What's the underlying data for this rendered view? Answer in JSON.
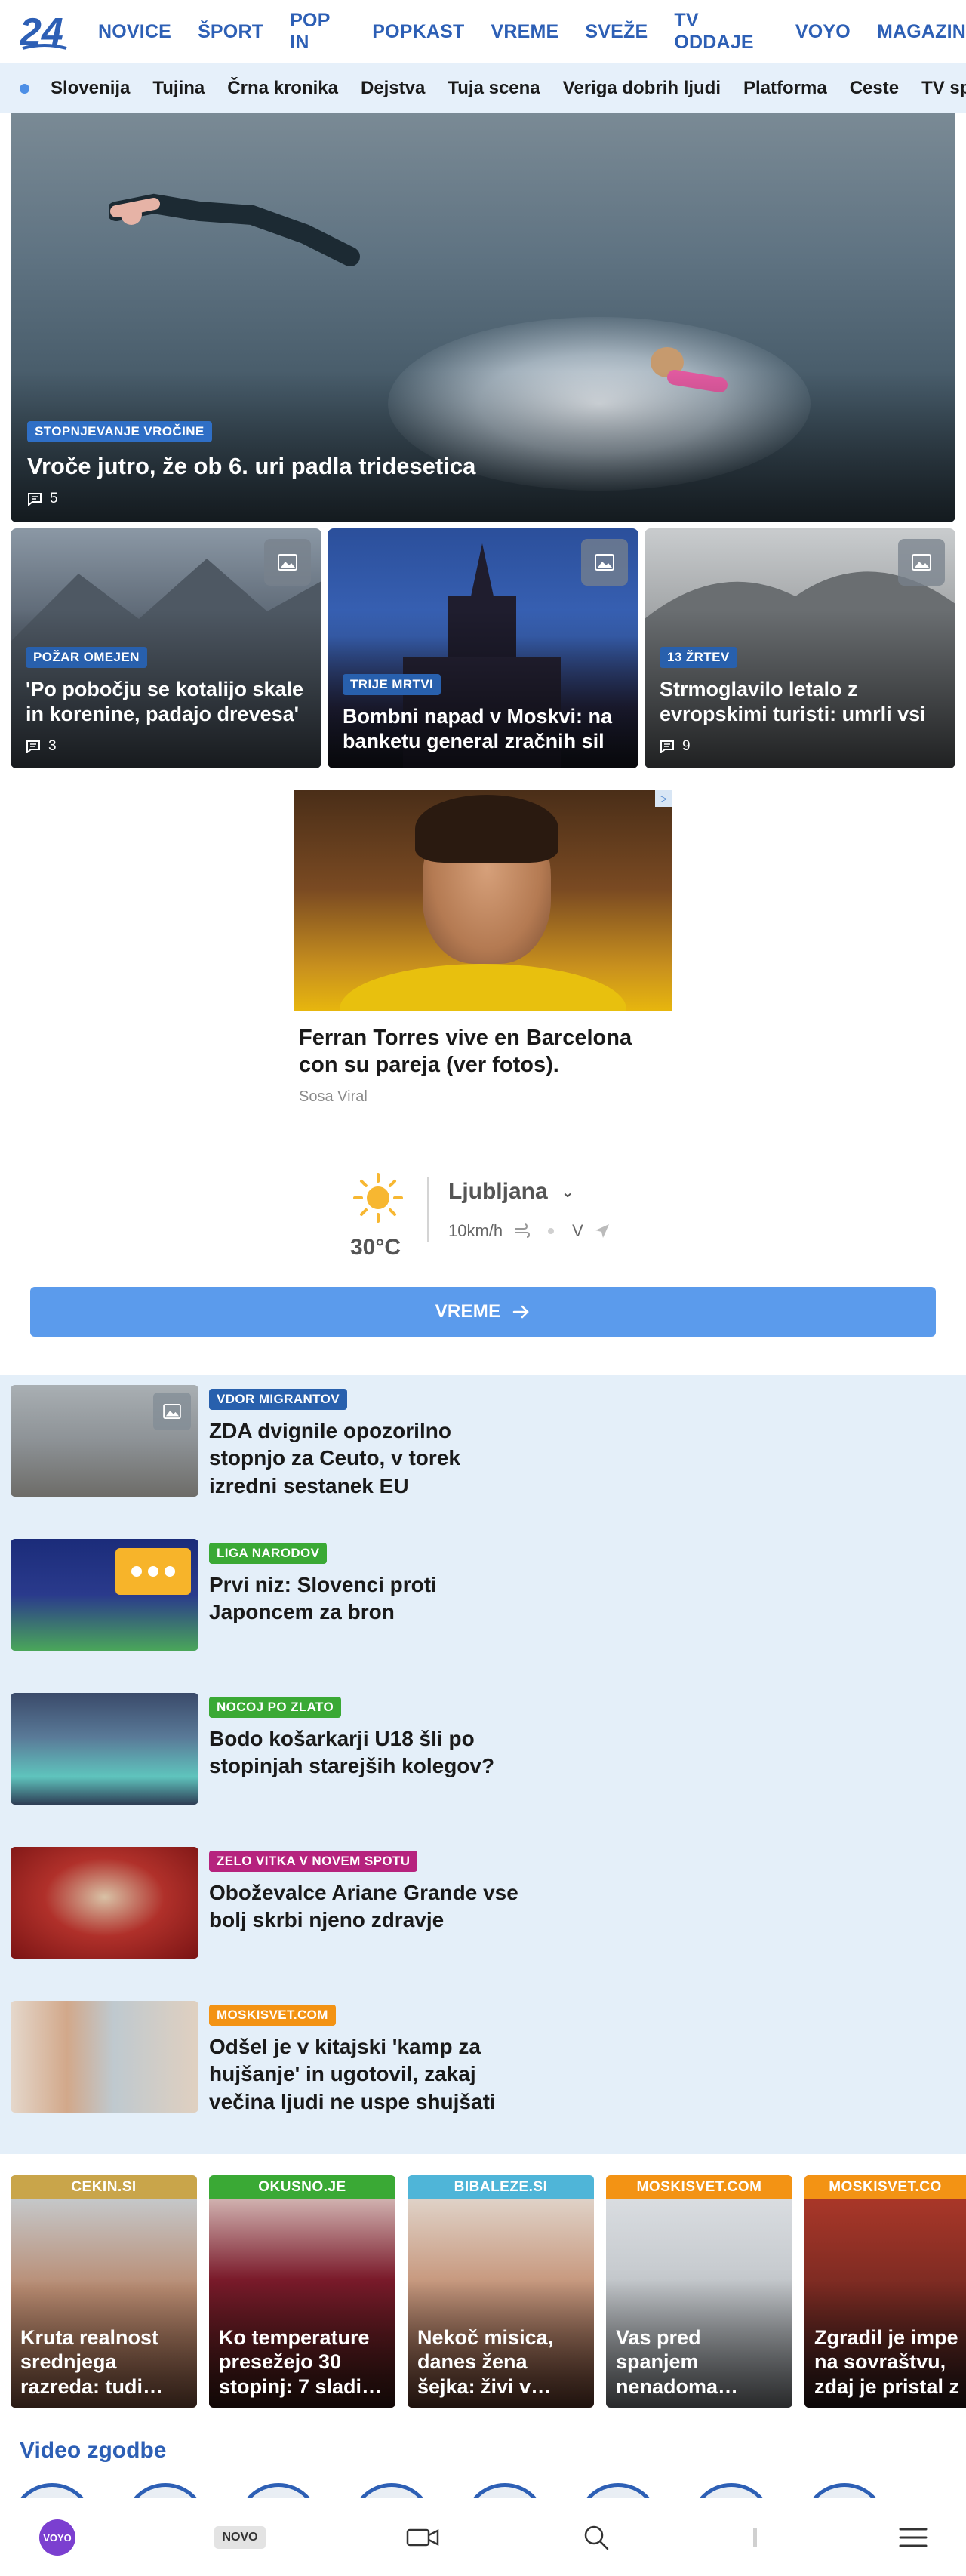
{
  "header": {
    "logo_text": "24",
    "nav": [
      "NOVICE",
      "ŠPORT",
      "POP IN",
      "POPKAST",
      "VREME",
      "SVEŽE",
      "TV ODDAJE",
      "VOYO",
      "MAGAZIN"
    ]
  },
  "subnav": [
    "Slovenija",
    "Tujina",
    "Črna kronika",
    "Dejstva",
    "Tuja scena",
    "Veriga dobrih ljudi",
    "Platforma",
    "Ceste",
    "TV spor"
  ],
  "hero": {
    "badge": "STOPNJEVANJE VROČINE",
    "title": "Vroče jutro, že ob 6. uri padla tridesetica",
    "comments": "5"
  },
  "cards": [
    {
      "badge": "POŽAR OMEJEN",
      "title": "'Po pobočju se kotalijo skale in korenine, padajo drevesa'",
      "comments": "3"
    },
    {
      "badge": "TRIJE MRTVI",
      "title": "Bombni napad v Moskvi: na banketu general zračnih sil",
      "comments": ""
    },
    {
      "badge": "13 ŽRTEV",
      "title": "Strmoglavilo letalo z evropskimi turisti: umrli vsi",
      "comments": "9"
    }
  ],
  "ad": {
    "title": "Ferran Torres vive en Barcelona con su pareja (ver fotos).",
    "source": "Sosa Viral",
    "adchoice": "▷"
  },
  "weather": {
    "temperature": "30°C",
    "city": "Ljubljana",
    "wind_speed": "10km/h",
    "wind_dir": "V",
    "button_label": "VREME"
  },
  "list": [
    {
      "badge": "VDOR MIGRANTOV",
      "badge_color": "#2860ad",
      "title": "ZDA dvignile opozorilno stopnjo za Ceuto, v torek izredni sestanek EU",
      "thumb_icon": "gallery-icon"
    },
    {
      "badge": "LIGA NARODOV",
      "badge_color": "#3aa935",
      "title": "Prvi niz: Slovenci proti Japoncem za bron",
      "thumb_icon": "live-dots-icon"
    },
    {
      "badge": "NOCOJ PO ZLATO",
      "badge_color": "#3aa935",
      "title": "Bodo košarkarji U18 šli po stopinjah starejših kolegov?",
      "thumb_icon": ""
    },
    {
      "badge": "ZELO VITKA V NOVEM SPOTU",
      "badge_color": "#b6237e",
      "title": "Oboževalce Ariane Grande vse bolj skrbi njeno zdravje",
      "thumb_icon": ""
    },
    {
      "badge": "MOSKISVET.COM",
      "badge_color": "#f39314",
      "title": "Odšel je v kitajski 'kamp za hujšanje' in ugotovil, zakaj večina ljudi ne uspe shujšati",
      "thumb_icon": ""
    }
  ],
  "partners": [
    {
      "source": "CEKIN.SI",
      "color": "#c9a54a",
      "title": "Kruta realnost srednjega razreda: tudi…"
    },
    {
      "source": "OKUSNO.JE",
      "color": "#3aa935",
      "title": "Ko temperature presežejo 30 stopinj: 7 sladi…"
    },
    {
      "source": "BIBALEZE.SI",
      "color": "#4fb5d8",
      "title": "Nekoč misica, danes žena šejka: živi v…"
    },
    {
      "source": "MOSKISVET.COM",
      "color": "#f39314",
      "title": "Vas pred spanjem nenadoma…"
    },
    {
      "source": "MOSKISVET.CO",
      "color": "#f39314",
      "title": "Zgradil je impe na sovraštvu, zdaj je pristal z"
    }
  ],
  "video": {
    "title": "Video  zgodbe"
  },
  "bottom": {
    "voyo": "VOYO",
    "novo": "NOVO"
  },
  "colors": {
    "brand_blue": "#2d5fb5",
    "light_bg": "#e4eff9",
    "button_blue": "#5b9bec"
  }
}
